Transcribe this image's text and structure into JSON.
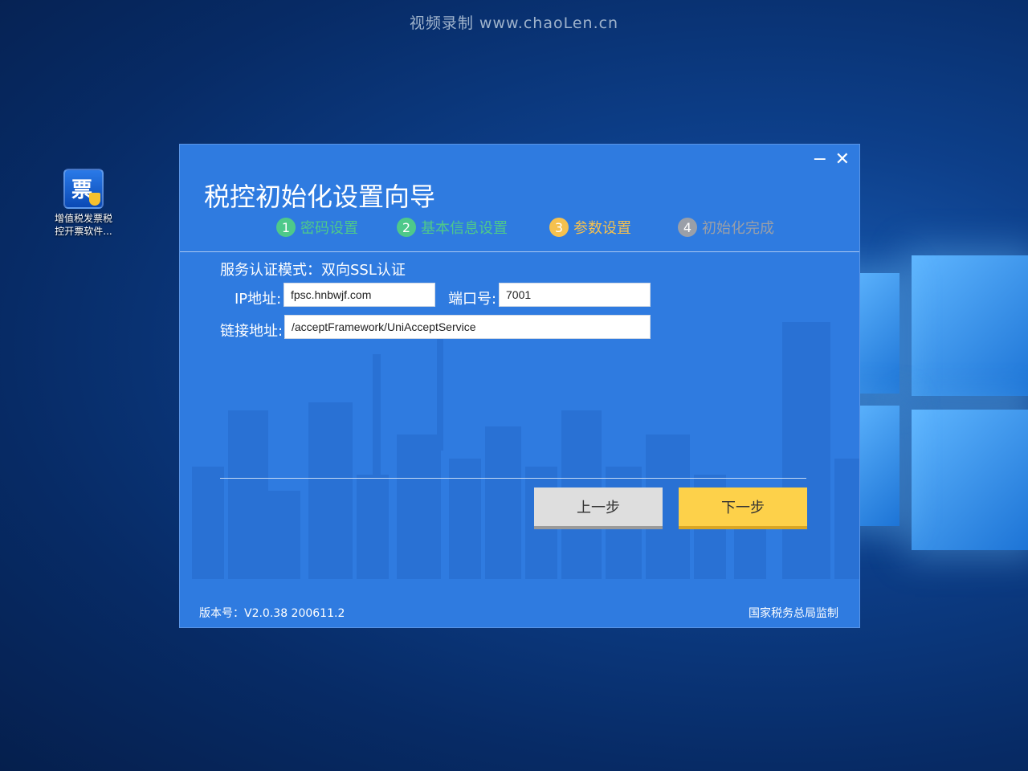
{
  "watermark": "视频录制 www.chaoLen.cn",
  "desktop_icon": {
    "glyph": "票",
    "label_line1": "增值税发票税",
    "label_line2": "控开票软件..."
  },
  "dialog": {
    "title": "税控初始化设置向导",
    "controls": {
      "minimize": "−",
      "close": "✕"
    },
    "steps": [
      {
        "num": "1",
        "label": "密码设置",
        "color": "#4ec98a"
      },
      {
        "num": "2",
        "label": "基本信息设置",
        "color": "#4ec98a"
      },
      {
        "num": "3",
        "label": "参数设置",
        "color": "#f6c14e"
      },
      {
        "num": "4",
        "label": "初始化完成",
        "color": "#9a9fa8"
      }
    ],
    "mode_text": "服务认证模式：双向SSL认证",
    "ip_label": "IP地址:",
    "ip_value": "fpsc.hnbwjf.com",
    "port_label": "端口号:",
    "port_value": "7001",
    "link_label": "链接地址:",
    "link_value": "/acceptFramework/UniAcceptService",
    "prev_button": "上一步",
    "next_button": "下一步",
    "version": "版本号：V2.0.38 200611.2",
    "authority": "国家税务总局监制"
  }
}
